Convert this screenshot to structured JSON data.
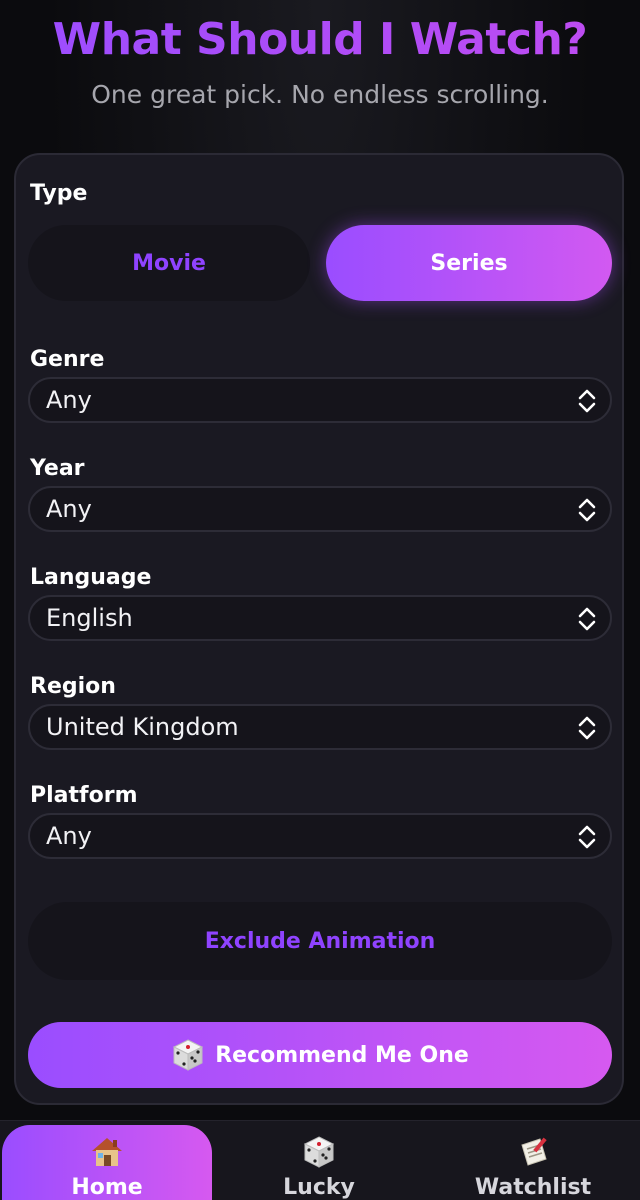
{
  "header": {
    "title": "What Should I Watch?",
    "subtitle": "One great pick. No endless scrolling."
  },
  "form": {
    "type_label": "Type",
    "type_options": [
      {
        "label": "Movie",
        "selected": false
      },
      {
        "label": "Series",
        "selected": true
      }
    ],
    "fields": [
      {
        "label": "Genre",
        "value": "Any"
      },
      {
        "label": "Year",
        "value": "Any"
      },
      {
        "label": "Language",
        "value": "English"
      },
      {
        "label": "Region",
        "value": "United Kingdom"
      },
      {
        "label": "Platform",
        "value": "Any"
      }
    ],
    "exclude_label": "Exclude Animation",
    "recommend_label": "Recommend Me One",
    "recommend_icon": "dice-icon"
  },
  "nav": {
    "items": [
      {
        "label": "Home",
        "icon": "house-icon",
        "active": true
      },
      {
        "label": "Lucky",
        "icon": "dice-icon",
        "active": false
      },
      {
        "label": "Watchlist",
        "icon": "memo-icon",
        "active": false
      }
    ]
  },
  "colors": {
    "accent_start": "#9a4dff",
    "accent_end": "#d659f0",
    "background": "#0d0d10",
    "card": "#1a1922"
  }
}
